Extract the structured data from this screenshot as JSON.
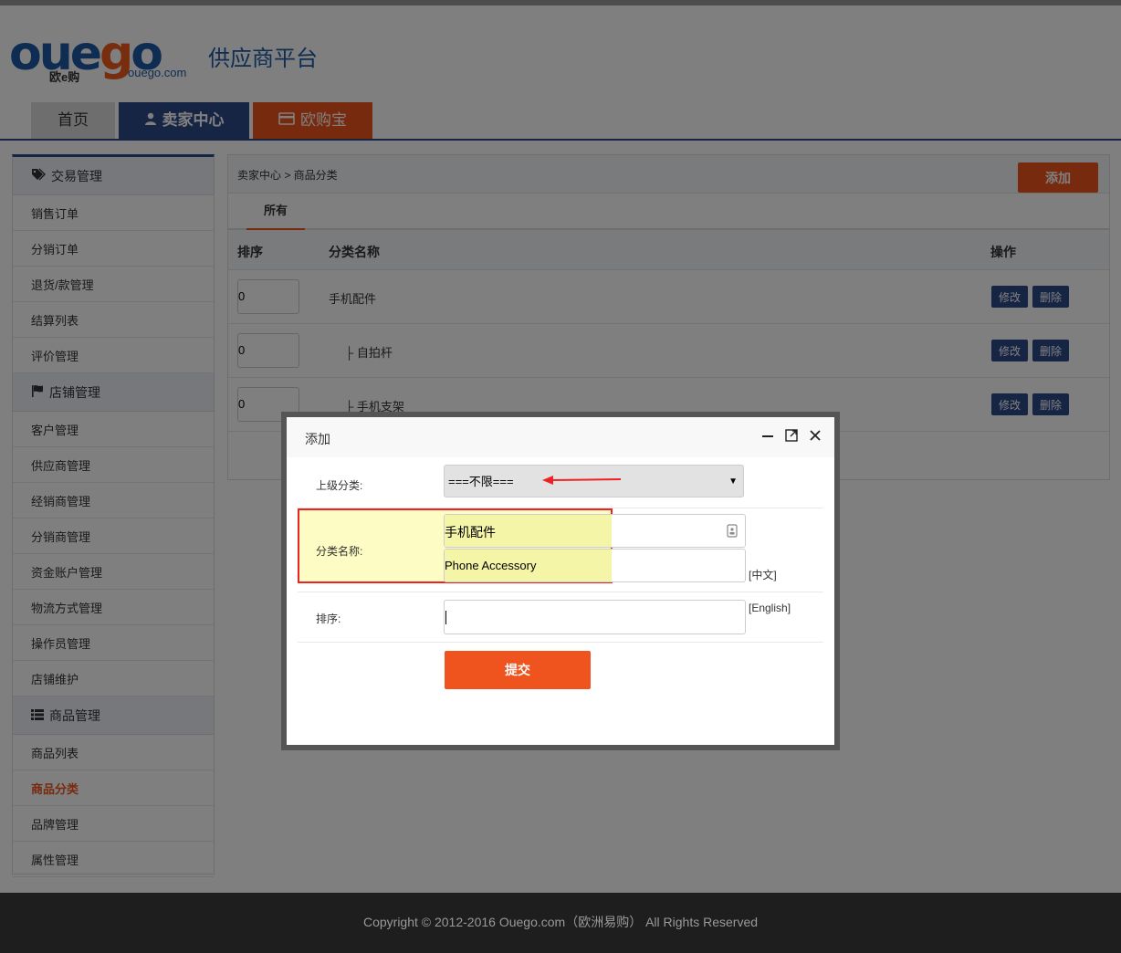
{
  "header": {
    "logo_text_blue": "oue",
    "logo_text_orange": "g",
    "logo_text_blue2": "o",
    "logo_sub": "欧e购",
    "logo_domain": "ouego.com",
    "platform_title": "供应商平台",
    "nav": [
      {
        "label": "首页"
      },
      {
        "label": "卖家中心",
        "icon": "user-icon"
      },
      {
        "label": "欧购宝",
        "icon": "card-icon"
      }
    ]
  },
  "sidebar": {
    "groups": [
      {
        "title": "交易管理",
        "icon": "tags-icon",
        "items": [
          "销售订单",
          "分销订单",
          "退货/款管理",
          "结算列表",
          "评价管理"
        ]
      },
      {
        "title": "店铺管理",
        "icon": "flag-icon",
        "items": [
          "客户管理",
          "供应商管理",
          "经销商管理",
          "分销商管理",
          "资金账户管理",
          "物流方式管理",
          "操作员管理",
          "店铺维护"
        ]
      },
      {
        "title": "商品管理",
        "icon": "list-icon",
        "items": [
          "商品列表",
          "商品分类",
          "品牌管理",
          "属性管理"
        ]
      }
    ],
    "active_item": "商品分类"
  },
  "main": {
    "breadcrumb": "卖家中心 > 商品分类",
    "add_label": "添加",
    "tab_all": "所有",
    "columns": {
      "sort": "排序",
      "name": "分类名称",
      "ops": "操作"
    },
    "rows": [
      {
        "sort": "0",
        "name": "手机配件",
        "indent": false
      },
      {
        "sort": "0",
        "name": "├ 自拍杆",
        "indent": true
      },
      {
        "sort": "0",
        "name": "├ 手机支架",
        "indent": true
      }
    ],
    "edit_label": "修改",
    "delete_label": "删除"
  },
  "dialog": {
    "title": "添加",
    "parent_label": "上级分类:",
    "parent_value": "===不限===",
    "name_label": "分类名称:",
    "name_cn": "手机配件",
    "name_en": "Phone Accessory",
    "tag_cn": "[中文]",
    "tag_en": "[English]",
    "sort_label": "排序:",
    "submit_label": "提交"
  },
  "footer": {
    "copyright": "Copyright © 2012-2016 Ouego.com（欧洲易购） All Rights Reserved"
  },
  "colors": {
    "brand_blue": "#2f4a8a",
    "accent_orange": "#f0541e",
    "highlight_red": "#e22"
  }
}
